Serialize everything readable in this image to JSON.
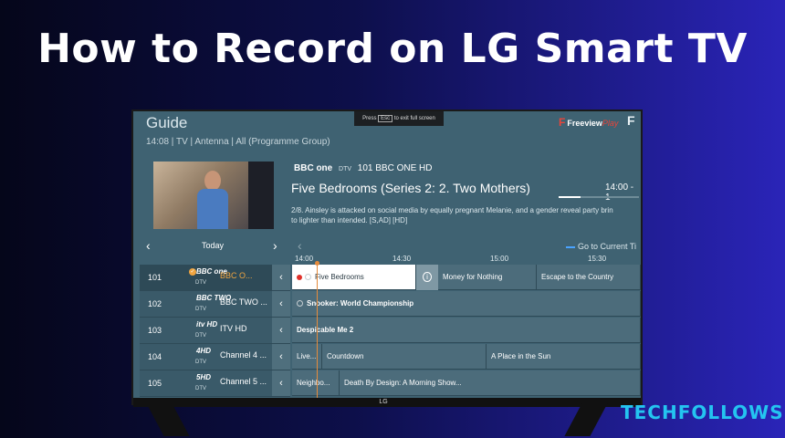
{
  "headline": "How to Record on LG Smart TV",
  "watermark": "TECHFOLLOWS",
  "tv": {
    "exit_banner": {
      "prefix": "Press",
      "key": "Esc",
      "suffix": "to exit full screen"
    },
    "brand_logo": "LG",
    "guide": {
      "title": "Guide",
      "subtitle": "14:08 | TV | Antenna | All (Programme Group)",
      "freeview": {
        "mark": "F",
        "text": "Freeview",
        "play": "Play"
      },
      "freeview_icon": "F",
      "preview": {
        "channel_logo": "BBC one",
        "dtv": "DTV",
        "channel": "101 BBC ONE HD",
        "title": "Five Bedrooms (Series 2: 2. Two Mothers)",
        "time": "14:00 - 1",
        "progress": 0.27,
        "description": "2/8. Ainsley is attacked on social media by equally pregnant Melanie, and a gender reveal party brin",
        "description2": "to lighter than intended. [S,AD] [HD]"
      },
      "nav": {
        "prev": "‹",
        "day": "Today",
        "next": "›",
        "grid_prev": "‹"
      },
      "go_to_current": "Go to Current Ti",
      "times": [
        "14:00",
        "14:30",
        "15:00",
        "15:30"
      ],
      "channels": [
        {
          "number": "101",
          "logo": "BBC one",
          "dtv": "DTV",
          "name": "BBC O...",
          "selected": true
        },
        {
          "number": "102",
          "logo": "BBC TWO",
          "dtv": "DTV",
          "name": "BBC TWO ..."
        },
        {
          "number": "103",
          "logo": "itv HD",
          "dtv": "DTV",
          "name": "ITV HD"
        },
        {
          "number": "104",
          "logo": "4HD",
          "dtv": "DTV",
          "name": "Channel 4 ..."
        },
        {
          "number": "105",
          "logo": "5HD",
          "dtv": "DTV",
          "name": "Channel 5 ..."
        }
      ],
      "programmes": {
        "row1": [
          "Five Bedrooms",
          "Money for Nothing",
          "Escape to the Country"
        ],
        "row2": [
          "Snooker: World Championship"
        ],
        "row3": [
          "Despicable Me 2"
        ],
        "row4": [
          "Live...",
          "Countdown",
          "A Place in the Sun"
        ],
        "row5": [
          "Neighbo...",
          "Death By Design: A Morning Show..."
        ]
      },
      "info_icon": "i",
      "row_arrow": "‹"
    }
  },
  "colors": {
    "accent_orange": "#e58b3c",
    "record_red": "#e0312b",
    "guide_bg": "#3f6272",
    "watermark": "#24c4f0"
  }
}
